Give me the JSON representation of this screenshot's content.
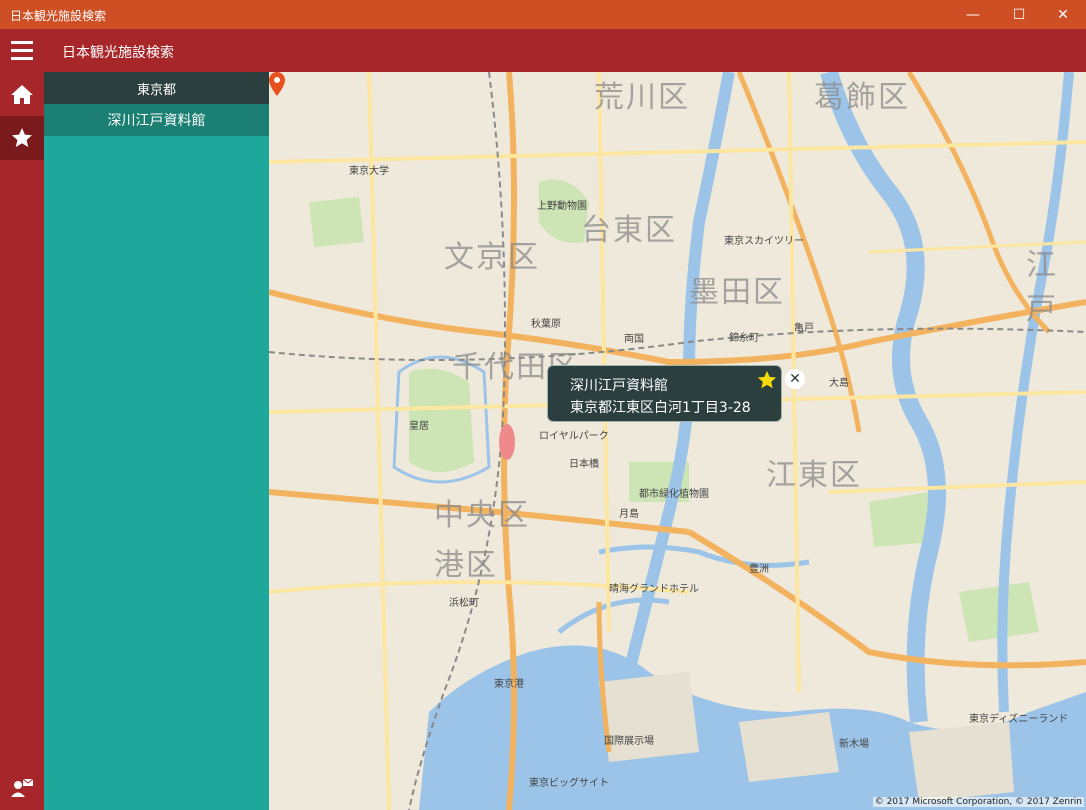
{
  "window": {
    "title": "日本観光施設検索",
    "minimize_glyph": "—",
    "maximize_glyph": "☐",
    "close_glyph": "✕"
  },
  "appbar": {
    "title": "日本観光施設検索"
  },
  "rail": {
    "home_icon": "home-icon",
    "favorites_icon": "star-icon",
    "feedback_icon": "feedback-icon"
  },
  "panel": {
    "prefecture": "東京都",
    "items": [
      {
        "label": "深川江戸資料館"
      }
    ]
  },
  "map": {
    "districts": [
      "荒川区",
      "葛飾区",
      "台東区",
      "文京区",
      "墨田区",
      "千代田区",
      "江戸",
      "江東区",
      "中央区",
      "港区"
    ],
    "pois": [
      "東京大学",
      "上野動物園",
      "東京スカイツリー",
      "秋葉原",
      "皇居",
      "ロイヤルパーク",
      "日本橋",
      "深川江戸資料館",
      "晴海グランドホテル",
      "都市緑化植物園",
      "東京ディズニーランド",
      "国際展示場",
      "東京ビッグサイト",
      "浜松町",
      "新木場",
      "両国",
      "錦糸町",
      "亀戸",
      "大島",
      "月島",
      "豊洲",
      "東京港"
    ],
    "popup": {
      "name": "深川江戸資料館",
      "address": "東京都江東区白河1丁目3-28",
      "star_icon": "star-icon",
      "close_glyph": "✕"
    },
    "copyright": "© 2017 Microsoft Corporation, © 2017 Zenrin"
  },
  "colors": {
    "titlebar": "#cf4f24",
    "appbar": "#a6262a",
    "panel": "#1ea89b",
    "panel_header": "#2a3f3e",
    "panel_item": "#1b7f74",
    "water": "#9cc4e8",
    "pin": "#e8501d"
  }
}
